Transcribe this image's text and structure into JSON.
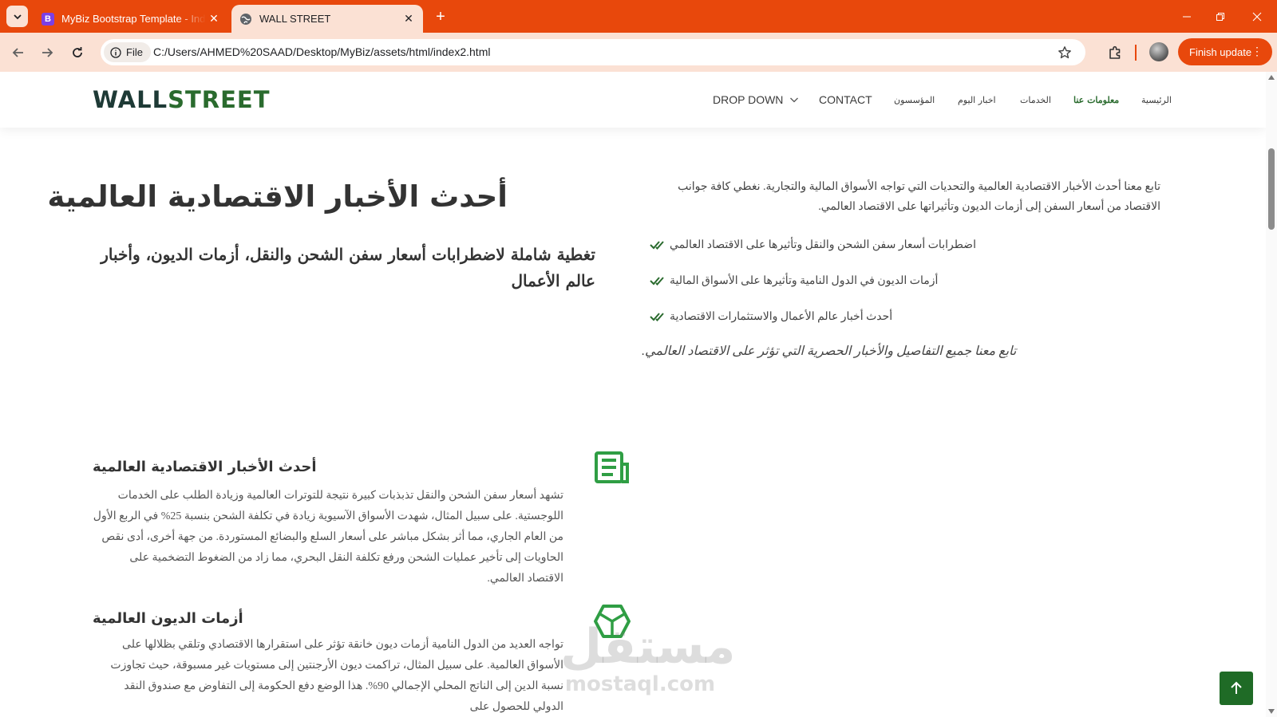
{
  "browser": {
    "tabs": [
      {
        "title": "MyBiz Bootstrap Template - Index",
        "favicon": "B"
      },
      {
        "title": "WALL STREET",
        "favicon": "globe-icon"
      }
    ],
    "site_chip": "File",
    "url": "C:/Users/AHMED%20SAAD/Desktop/MyBiz/assets/html/index2.html",
    "finish_update": "Finish update",
    "accent_color": "#e8480c"
  },
  "site": {
    "logo": {
      "part1": "WALL",
      "part2": "STREET"
    },
    "nav": {
      "dropdown": "DROP DOWN",
      "contact": "CONTACT",
      "founders": "المؤسسون",
      "today_news": "اخبار اليوم",
      "services": "الخدمات",
      "about": "معلومات عنا",
      "home": "الرئيسية"
    },
    "hero": {
      "title": "أحدث الأخبار الاقتصادية العالمية",
      "subtitle": "تغطية شاملة لاضطرابات أسعار سفن الشحن والنقل، أزمات الديون، وأخبار عالم الأعمال"
    },
    "intro": {
      "text": "تابع معنا أحدث الأخبار الاقتصادية العالمية والتحديات التي تواجه الأسواق المالية والتجارية. نغطي كافة جوانب الاقتصاد من أسعار السفن إلى أزمات الديون وتأثيراتها على الاقتصاد العالمي.",
      "items": [
        "اضطرابات أسعار سفن الشحن والنقل وتأثيرها على الاقتصاد العالمي",
        "أزمات الديون في الدول النامية وتأثيرها على الأسواق المالية",
        "أحدث أخبار عالم الأعمال والاستثمارات الاقتصادية"
      ],
      "italic": "تابع معنا جميع التفاصيل والأخبار الحصرية التي تؤثر على الاقتصاد العالمي."
    },
    "services": [
      {
        "icon": "news-icon",
        "title": "أحدث الأخبار الاقتصادية العالمية",
        "desc": "تشهد أسعار سفن الشحن والنقل تذبذبات كبيرة نتيجة للتوترات العالمية وزيادة الطلب على الخدمات اللوجستية. على سبيل المثال، شهدت الأسواق الآسيوية زيادة في تكلفة الشحن بنسبة 25% في الربع الأول من العام الجاري، مما أثر بشكل مباشر على أسعار السلع والبضائع المستوردة. من جهة أخرى، أدى نقص الحاويات إلى تأخير عمليات الشحن ورفع تكلفة النقل البحري، مما زاد من الضغوط التضخمية على الاقتصاد العالمي."
      },
      {
        "icon": "cube-icon",
        "title": "أزمات الديون العالمية",
        "desc": "تواجه العديد من الدول النامية أزمات ديون خانقة تؤثر على استقرارها الاقتصادي وتلقي بظلالها على الأسواق العالمية. على سبيل المثال، تراكمت ديون الأرجنتين إلى مستويات غير مسبوقة، حيث تجاوزت نسبة الدين إلى الناتج المحلي الإجمالي 90%. هذا الوضع دفع الحكومة إلى التفاوض مع صندوق النقد الدولي للحصول على"
      }
    ],
    "watermark": {
      "ar": "مستقل",
      "en": "mostaql.com"
    },
    "brand_green": "#2a6b2e"
  }
}
